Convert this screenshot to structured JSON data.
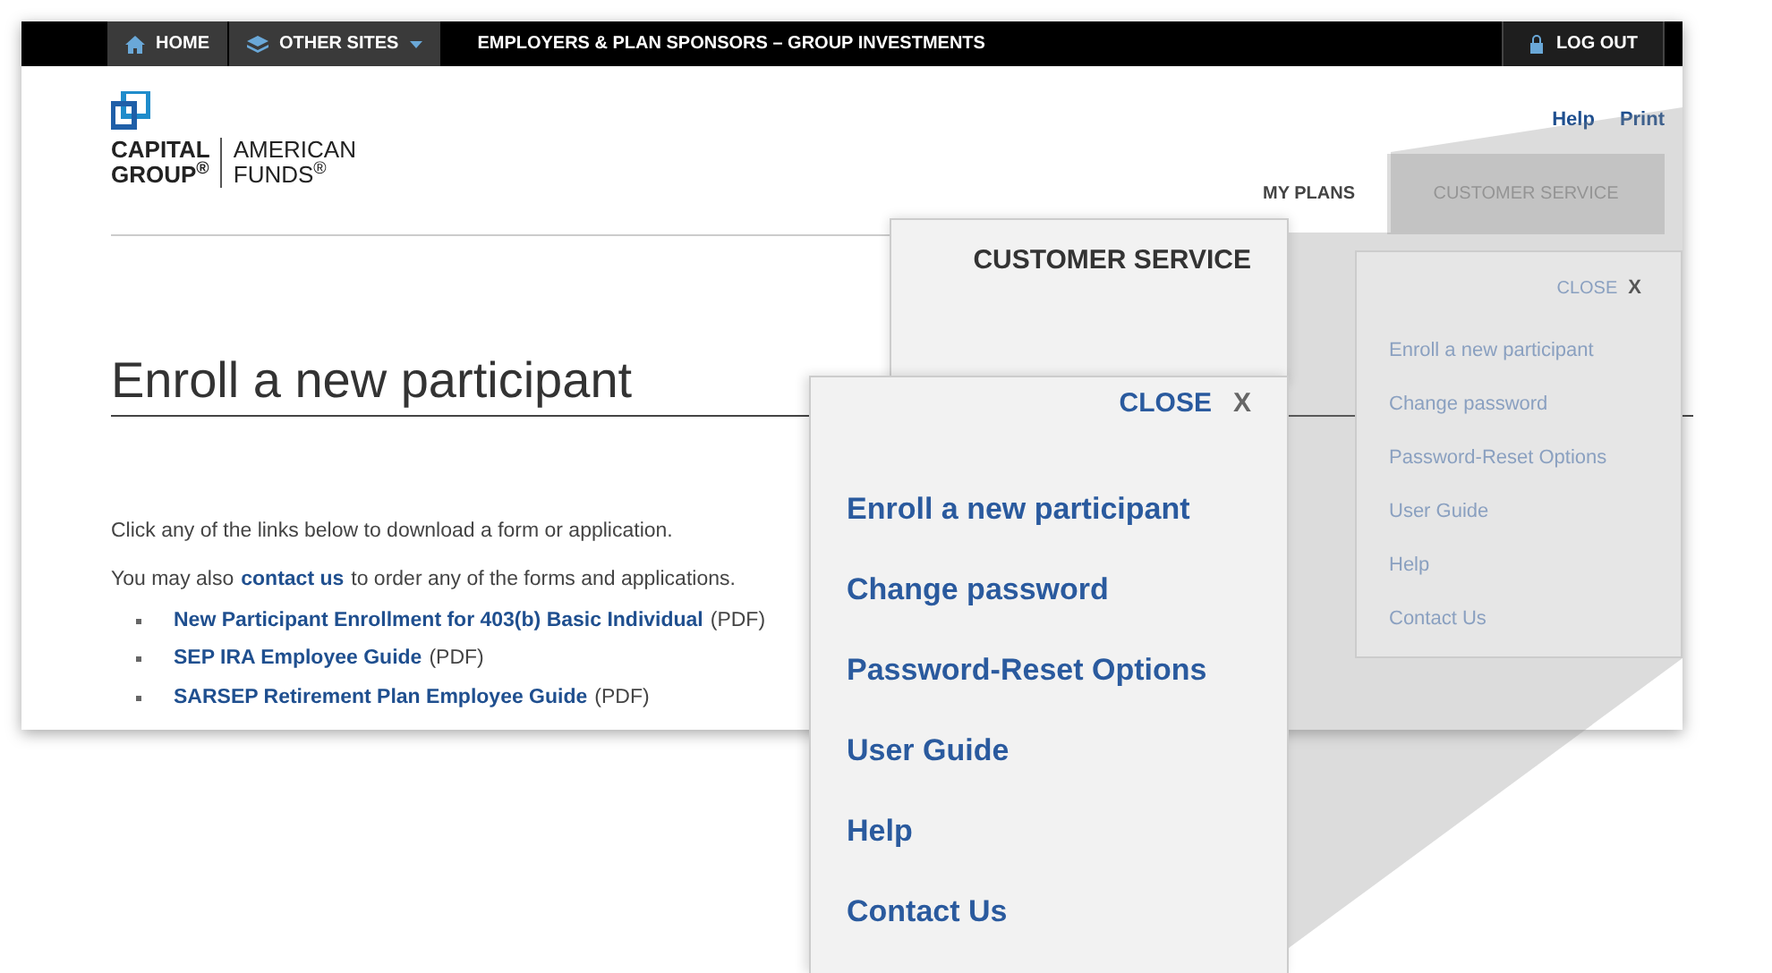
{
  "top_bar": {
    "items": [
      {
        "label": "HOME",
        "kind": "home"
      },
      {
        "label": "OTHER SITES",
        "kind": "dropdown"
      }
    ],
    "title": "EMPLOYERS & PLAN SPONSORS – GROUP INVESTMENTS",
    "logout": "LOG OUT"
  },
  "logo": {
    "left_top": "CAPITAL",
    "left_bottom": "GROUP$^{®}$",
    "right_top": "AMERICAN",
    "right_bottom": "FUNDS$^{®}$"
  },
  "utility_links": [
    "Help",
    "Print"
  ],
  "nav": [
    {
      "label": "MY PLANS",
      "selected": false
    },
    {
      "label": "CUSTOMER SERVICE",
      "selected": true
    }
  ],
  "page_title": "Enroll a new participant",
  "intro": "Click any of the links below to download a form or application.",
  "contact_line": {
    "before": "You may also",
    "link": "contact us",
    "after": "to order any of the forms and applications."
  },
  "downloads": [
    {
      "title": "New Participant Enrollment for 403(b) Basic Individual",
      "suffix": "(PDF)"
    },
    {
      "title": "SEP IRA Employee Guide",
      "suffix": "(PDF)"
    },
    {
      "title": "SARSEP Retirement Plan Employee Guide",
      "suffix": "(PDF)"
    }
  ],
  "menu": {
    "close": "CLOSE",
    "close_icon": "X",
    "items": [
      "Enroll a new participant",
      "Change password",
      "Password-Reset Options",
      "User Guide",
      "Help",
      "Contact Us"
    ]
  },
  "callout": {
    "tab": "CUSTOMER SERVICE",
    "close": "CLOSE",
    "close_icon": "X",
    "items": [
      "Enroll a new participant",
      "Change password",
      "Password-Reset Options",
      "User Guide",
      "Help",
      "Contact Us"
    ]
  }
}
